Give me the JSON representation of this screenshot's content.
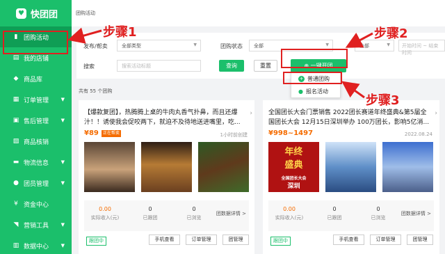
{
  "app": {
    "name": "快团团"
  },
  "sidebar": {
    "items": [
      {
        "label": "团购活动",
        "icon": "bookmark-icon",
        "active": true,
        "expandable": false
      },
      {
        "label": "我的店铺",
        "icon": "store-icon",
        "expandable": false
      },
      {
        "label": "商品库",
        "icon": "cube-icon",
        "expandable": false
      },
      {
        "label": "订单管理",
        "icon": "list-icon",
        "expandable": true
      },
      {
        "label": "售后管理",
        "icon": "return-icon",
        "expandable": true
      },
      {
        "label": "商品核销",
        "icon": "verify-icon",
        "expandable": false
      },
      {
        "label": "物流信息",
        "icon": "truck-icon",
        "expandable": true
      },
      {
        "label": "团员管理",
        "icon": "user-icon",
        "expandable": true
      },
      {
        "label": "资金中心",
        "icon": "yuan-icon",
        "expandable": false
      },
      {
        "label": "营销工具",
        "icon": "tag-icon",
        "expandable": true
      },
      {
        "label": "数据中心",
        "icon": "chart-icon",
        "expandable": true
      }
    ]
  },
  "breadcrumb": "团购活动",
  "filters": {
    "publish_label": "发布/帮卖",
    "type_value": "全部类型",
    "status_label": "团购状态",
    "status_value": "全部",
    "extra_value": "全部",
    "start_time_placeholder": "开始时间",
    "to": "~",
    "end_time_placeholder": "结束时间",
    "search_label": "搜索",
    "search_placeholder": "搜索活动标题",
    "query_button": "查询",
    "reset_button": "重置",
    "open_button": "一键开团"
  },
  "dropdown": {
    "items": [
      {
        "label": "普通团购",
        "icon": "plus-circle-icon"
      },
      {
        "label": "报名活动",
        "icon": "user-icon"
      }
    ]
  },
  "annotations": {
    "step1": "步骤1",
    "step2": "步骤2",
    "step3": "步骤3"
  },
  "summary": "共有 55 个团购",
  "cards": [
    {
      "title": "【爆款复团】，热腾腾上桌的牛肉丸香气扑鼻，而且还爆汁！！诱使我会促咬两下，就迫不及待地送进嘴里，吃...",
      "price": "¥89",
      "tag": "正在帮卖",
      "time": "1小时前创建",
      "stats": [
        {
          "value": "0.00",
          "label": "实际收入(元)"
        },
        {
          "value": "0",
          "label": "已跟团"
        },
        {
          "value": "0",
          "label": "已浏览"
        }
      ],
      "detail_link": "团数据详情 >",
      "status": "跟团中",
      "buttons": [
        "手机查看",
        "订单管理",
        "团管理"
      ]
    },
    {
      "title": "全国团长大会门票销售 2022团长赛道年终盛典&第5届全国团长大会 12月15日深圳举办 100万团长，影响5亿消...",
      "price": "¥998~1497",
      "time": "2022.08.24",
      "stats": [
        {
          "value": "0.00",
          "label": "实际收入(元)"
        },
        {
          "value": "0",
          "label": "已跟团"
        },
        {
          "value": "0",
          "label": "已浏览"
        }
      ],
      "detail_link": "团数据详情 >",
      "status": "跟团中",
      "buttons": [
        "手机查看",
        "订单管理",
        "团管理"
      ]
    }
  ],
  "poster": {
    "line1": "年终",
    "line2": "盛典",
    "line3": "全国团长大会",
    "line4": "深圳"
  },
  "colors": {
    "brand": "#1bbf6b",
    "annotation": "#e02020",
    "price": "#f56c00"
  }
}
